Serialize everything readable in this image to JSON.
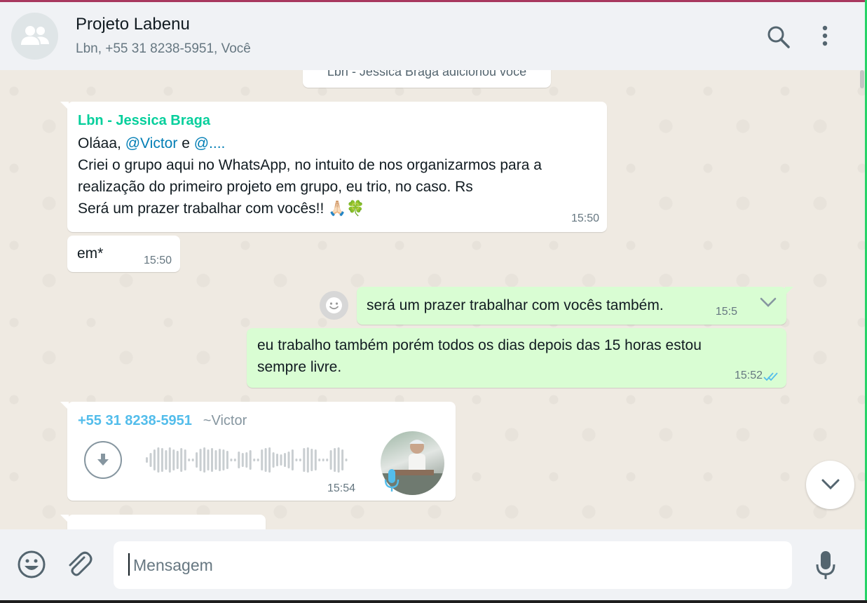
{
  "header": {
    "group_name": "Projeto Labenu",
    "members": "Lbn, +55 31 8238-5951, Você"
  },
  "system_message": "Lbn - Jessica Braga adicionou você",
  "messages": {
    "m1": {
      "sender": "Lbn - Jessica Braga",
      "greeting": "Oláaa,",
      "mention1": "@Victor",
      "connector": "e",
      "mention2": "@....",
      "line2": "Criei o grupo aqui no WhatsApp, no intuito de nos organizarmos para a",
      "line3": "realização do primeiro projeto em grupo, eu trio, no caso. Rs",
      "line4": "Será um prazer trabalhar com vocês!! 🙏🏻🍀",
      "time": "15:50"
    },
    "m2": {
      "text": "em*",
      "time": "15:50"
    },
    "m3": {
      "text": "será um prazer trabalhar com vocês também.",
      "time": "15:5"
    },
    "m4": {
      "line1": "eu trabalho também porém todos os dias depois das 15 horas estou",
      "line2": "sempre livre.",
      "time": "15:52"
    },
    "m5": {
      "phone": "+55 31 8238-5951",
      "alias": "~Victor",
      "time": "15:54"
    }
  },
  "composer": {
    "placeholder": "Mensagem"
  },
  "colors": {
    "outgoing_bubble": "#d9fdd3",
    "incoming_bubble": "#ffffff",
    "sender_jessica": "#06cf9c",
    "sender_victor": "#53bdeb",
    "mention": "#027eb5",
    "read_ticks": "#53bdeb"
  },
  "icons": [
    "group-avatar-icon",
    "search-icon",
    "menu-icon",
    "smiley-icon",
    "chevron-down-icon",
    "double-check-icon",
    "download-icon",
    "mic-icon",
    "emoji-icon",
    "attach-icon"
  ]
}
